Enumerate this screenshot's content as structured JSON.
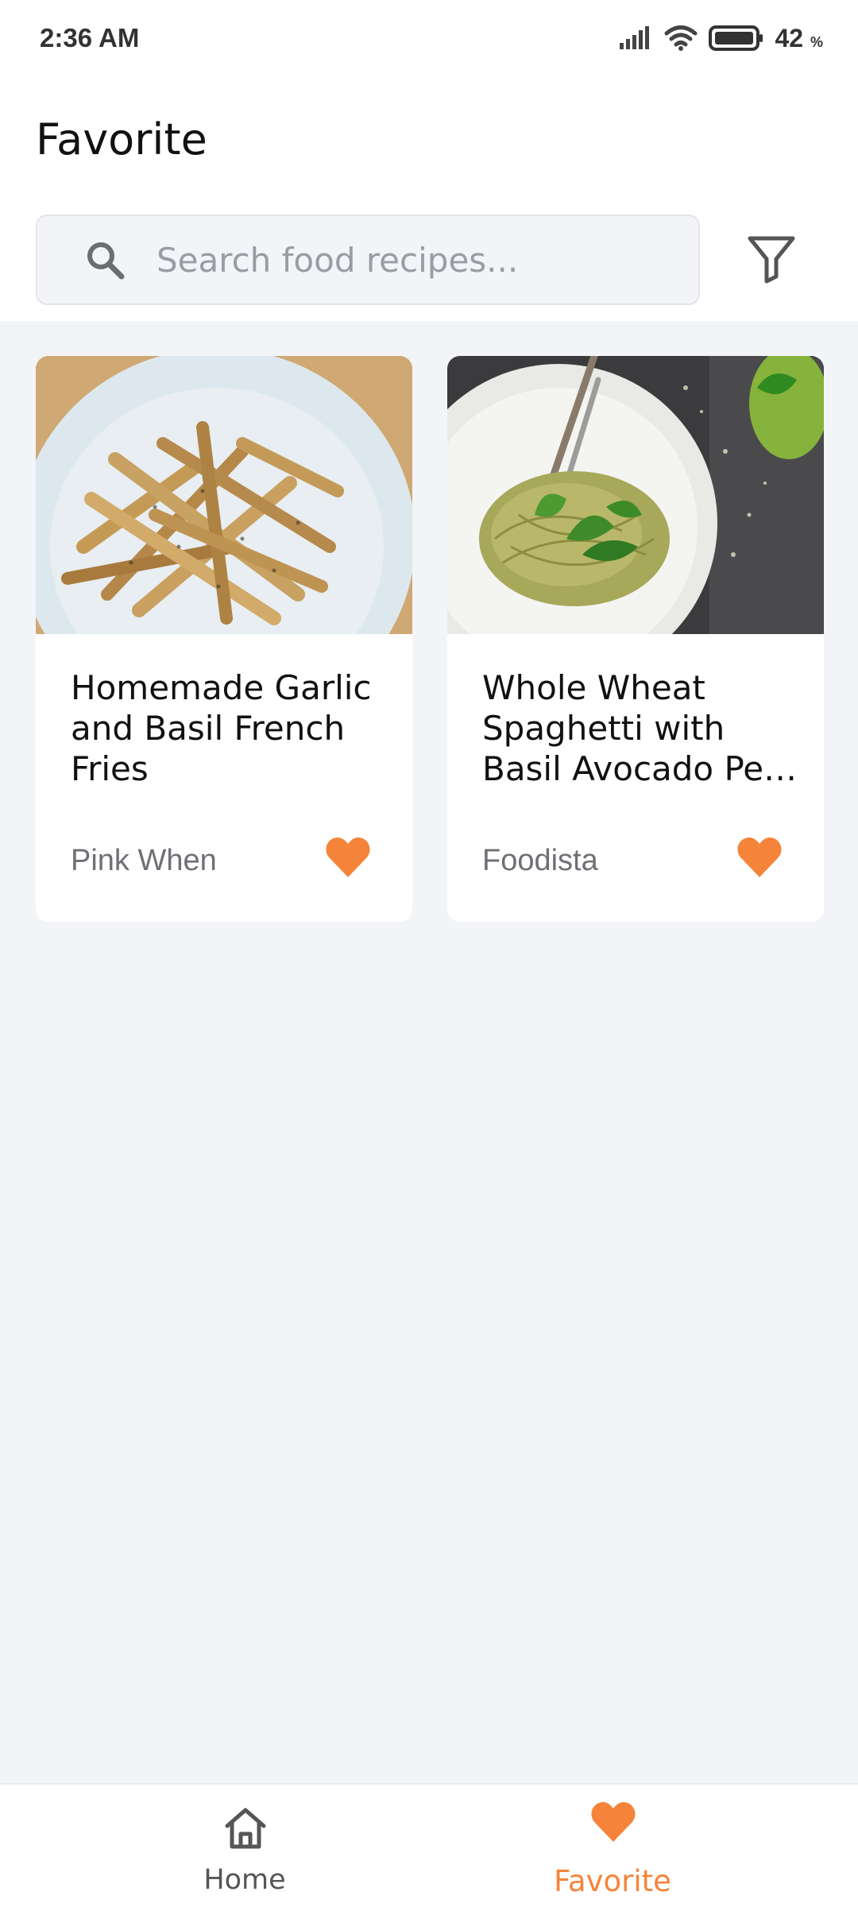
{
  "status_bar": {
    "time": "2:36 AM",
    "battery_percent": "42",
    "battery_unit": "%",
    "icons": [
      "signal-icon",
      "wifi-icon",
      "battery-icon"
    ]
  },
  "header": {
    "title": "Favorite",
    "search": {
      "placeholder": "Search food recipes...",
      "value": ""
    },
    "filter_icon": "filter-icon"
  },
  "cards": [
    {
      "title": "Homemade Garlic and Basil French Fries",
      "source": "Pink When",
      "favorited": true,
      "image": "french-fries-photo"
    },
    {
      "title": "Whole Wheat Spaghetti with Basil Avocado Pe…",
      "source": "Foodista",
      "favorited": true,
      "image": "pesto-spaghetti-photo"
    }
  ],
  "bottom_nav": {
    "items": [
      {
        "label": "Home",
        "icon": "home-icon",
        "active": false
      },
      {
        "label": "Favorite",
        "icon": "heart-icon",
        "active": true
      }
    ]
  },
  "colors": {
    "accent": "#f5843a",
    "background": "#f3f4f8",
    "text_primary": "#111111",
    "text_secondary": "#6f7075"
  }
}
